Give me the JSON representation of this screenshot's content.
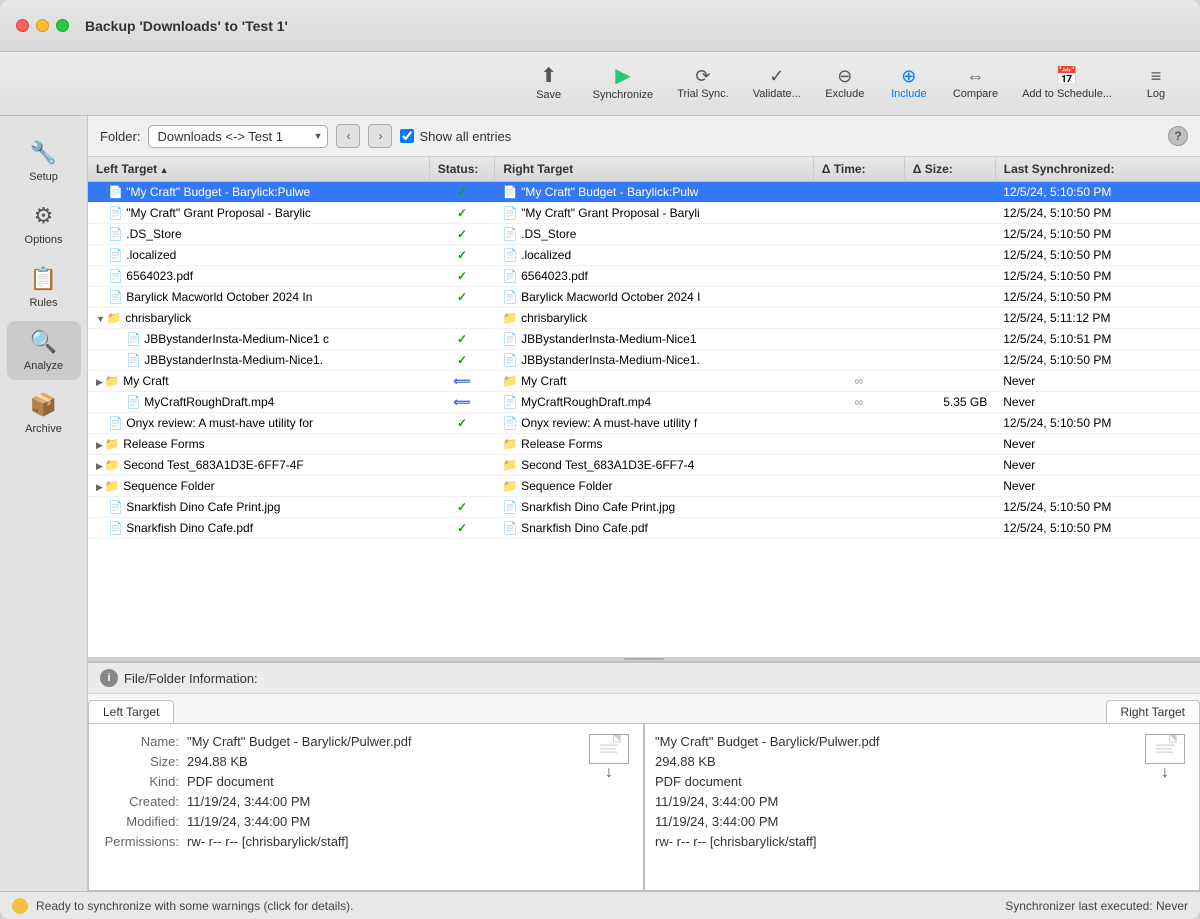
{
  "window": {
    "title": "Backup 'Downloads' to 'Test 1'"
  },
  "toolbar": {
    "items": [
      {
        "id": "save",
        "label": "Save",
        "icon": "⬆"
      },
      {
        "id": "synchronize",
        "label": "Synchronize",
        "icon": "▶"
      },
      {
        "id": "trial-sync",
        "label": "Trial Sync.",
        "icon": "⟳"
      },
      {
        "id": "validate",
        "label": "Validate...",
        "icon": "✓"
      },
      {
        "id": "exclude",
        "label": "Exclude",
        "icon": "⊖"
      },
      {
        "id": "include",
        "label": "Include",
        "icon": "⊕"
      },
      {
        "id": "compare",
        "label": "Compare",
        "icon": "⇔"
      },
      {
        "id": "add-schedule",
        "label": "Add to Schedule...",
        "icon": "📅"
      },
      {
        "id": "log",
        "label": "Log",
        "icon": "≡"
      }
    ]
  },
  "sidebar": {
    "items": [
      {
        "id": "setup",
        "label": "Setup",
        "icon": "🔧"
      },
      {
        "id": "options",
        "label": "Options",
        "icon": "⚙"
      },
      {
        "id": "rules",
        "label": "Rules",
        "icon": "📋"
      },
      {
        "id": "analyze",
        "label": "Analyze",
        "icon": "🔍"
      },
      {
        "id": "archive",
        "label": "Archive",
        "icon": "📦"
      }
    ]
  },
  "folder_bar": {
    "label": "Folder:",
    "folder_value": "Downloads <-> Test 1",
    "show_all_label": "Show all entries",
    "show_all_checked": true
  },
  "table": {
    "headers": {
      "left_target": "Left Target",
      "status": "Status:",
      "right_target": "Right Target",
      "delta_time": "Δ Time:",
      "delta_size": "Δ Size:",
      "last_sync": "Last Synchronized:"
    },
    "rows": [
      {
        "id": "row-1",
        "selected": true,
        "indent": 0,
        "expand": false,
        "left_icon": "📄",
        "left_name": "\"My Craft\" Budget - Barylick:Pulwe",
        "status": "✓",
        "right_icon": "📄",
        "right_name": "\"My Craft\" Budget - Barylick:Pulw",
        "delta_time": "",
        "delta_size": "",
        "last_sync": "12/5/24, 5:10:50 PM"
      },
      {
        "id": "row-2",
        "selected": false,
        "indent": 0,
        "expand": false,
        "left_icon": "📄",
        "left_name": "\"My Craft\" Grant Proposal - Barylic",
        "status": "✓",
        "right_icon": "📄",
        "right_name": "\"My Craft\" Grant Proposal - Baryli",
        "delta_time": "",
        "delta_size": "",
        "last_sync": "12/5/24, 5:10:50 PM"
      },
      {
        "id": "row-3",
        "selected": false,
        "indent": 0,
        "expand": false,
        "left_icon": "📄",
        "left_name": ".DS_Store",
        "status": "✓",
        "right_icon": "📄",
        "right_name": ".DS_Store",
        "delta_time": "",
        "delta_size": "",
        "last_sync": "12/5/24, 5:10:50 PM"
      },
      {
        "id": "row-4",
        "selected": false,
        "indent": 0,
        "expand": false,
        "left_icon": "📄",
        "left_name": ".localized",
        "status": "✓",
        "right_icon": "📄",
        "right_name": ".localized",
        "delta_time": "",
        "delta_size": "",
        "last_sync": "12/5/24, 5:10:50 PM"
      },
      {
        "id": "row-5",
        "selected": false,
        "indent": 0,
        "expand": false,
        "left_icon": "📄",
        "left_name": "6564023.pdf",
        "status": "✓",
        "right_icon": "📄",
        "right_name": "6564023.pdf",
        "delta_time": "",
        "delta_size": "",
        "last_sync": "12/5/24, 5:10:50 PM"
      },
      {
        "id": "row-6",
        "selected": false,
        "indent": 0,
        "expand": false,
        "left_icon": "📄",
        "left_name": "Barylick Macworld October 2024 In",
        "status": "✓",
        "right_icon": "📄",
        "right_name": "Barylick Macworld October 2024 I",
        "delta_time": "",
        "delta_size": "",
        "last_sync": "12/5/24, 5:10:50 PM"
      },
      {
        "id": "row-7",
        "selected": false,
        "indent": 0,
        "expand": true,
        "folder": true,
        "left_icon": "📁",
        "left_name": "chrisbarylick",
        "status": "",
        "right_icon": "📁",
        "right_name": "chrisbarylick",
        "delta_time": "",
        "delta_size": "",
        "last_sync": "12/5/24, 5:11:12 PM"
      },
      {
        "id": "row-8",
        "selected": false,
        "indent": 1,
        "expand": false,
        "left_icon": "📄",
        "left_name": "JBBystanderInsta-Medium-Nice1 c",
        "status": "✓",
        "right_icon": "📄",
        "right_name": "JBBystanderInsta-Medium-Nice1",
        "delta_time": "",
        "delta_size": "",
        "last_sync": "12/5/24, 5:10:51 PM"
      },
      {
        "id": "row-9",
        "selected": false,
        "indent": 1,
        "expand": false,
        "left_icon": "📄",
        "left_name": "JBBystanderInsta-Medium-Nice1.",
        "status": "✓",
        "right_icon": "📄",
        "right_name": "JBBystanderInsta-Medium-Nice1.",
        "delta_time": "",
        "delta_size": "",
        "last_sync": "12/5/24, 5:10:50 PM"
      },
      {
        "id": "row-10",
        "selected": false,
        "indent": 0,
        "expand": false,
        "folder": true,
        "left_icon": "📁",
        "left_name": "My Craft",
        "status": "←",
        "right_icon": "📁",
        "right_name": "My Craft",
        "delta_time": "∞",
        "delta_size": "",
        "last_sync": "Never"
      },
      {
        "id": "row-11",
        "selected": false,
        "indent": 1,
        "expand": false,
        "left_icon": "📄",
        "left_name": "MyCraftRoughDraft.mp4",
        "status": "←",
        "right_icon": "📄",
        "right_name": "MyCraftRoughDraft.mp4",
        "delta_time": "∞",
        "delta_size": "5.35 GB",
        "last_sync": "Never"
      },
      {
        "id": "row-12",
        "selected": false,
        "indent": 0,
        "expand": false,
        "left_icon": "📄",
        "left_name": "Onyx review: A must-have utility for",
        "status": "✓",
        "right_icon": "📄",
        "right_name": "Onyx review: A must-have utility f",
        "delta_time": "",
        "delta_size": "",
        "last_sync": "12/5/24, 5:10:50 PM"
      },
      {
        "id": "row-13",
        "selected": false,
        "indent": 0,
        "expand": false,
        "folder": true,
        "expandable": true,
        "left_icon": "📁",
        "left_name": "Release Forms",
        "status": "",
        "right_icon": "📁",
        "right_name": "Release Forms",
        "delta_time": "",
        "delta_size": "",
        "last_sync": "Never"
      },
      {
        "id": "row-14",
        "selected": false,
        "indent": 0,
        "expand": false,
        "folder": true,
        "expandable": true,
        "left_icon": "📁",
        "left_name": "Second Test_683A1D3E-6FF7-4F",
        "status": "",
        "right_icon": "📁",
        "right_name": "Second Test_683A1D3E-6FF7-4",
        "delta_time": "",
        "delta_size": "",
        "last_sync": "Never"
      },
      {
        "id": "row-15",
        "selected": false,
        "indent": 0,
        "expand": false,
        "folder": true,
        "expandable": true,
        "left_icon": "📁",
        "left_name": "Sequence Folder",
        "status": "",
        "right_icon": "📁",
        "right_name": "Sequence Folder",
        "delta_time": "",
        "delta_size": "",
        "last_sync": "Never"
      },
      {
        "id": "row-16",
        "selected": false,
        "indent": 0,
        "expand": false,
        "left_icon": "📄",
        "left_name": "Snarkfish Dino Cafe Print.jpg",
        "status": "✓",
        "right_icon": "📄",
        "right_name": "Snarkfish Dino Cafe Print.jpg",
        "delta_time": "",
        "delta_size": "",
        "last_sync": "12/5/24, 5:10:50 PM"
      },
      {
        "id": "row-17",
        "selected": false,
        "indent": 0,
        "expand": false,
        "left_icon": "📄",
        "left_name": "Snarkfish Dino Cafe.pdf",
        "status": "✓",
        "right_icon": "📄",
        "right_name": "Snarkfish Dino Cafe.pdf",
        "delta_time": "",
        "delta_size": "",
        "last_sync": "12/5/24, 5:10:50 PM"
      }
    ]
  },
  "bottom_panel": {
    "title": "File/Folder Information:",
    "left_tab": "Left Target",
    "right_tab": "Right Target",
    "left_info": {
      "name_label": "Name:",
      "name_value": "\"My Craft\" Budget - Barylick/Pulwer.pdf",
      "size_label": "Size:",
      "size_value": "294.88 KB",
      "kind_label": "Kind:",
      "kind_value": "PDF document",
      "created_label": "Created:",
      "created_value": "11/19/24, 3:44:00 PM",
      "modified_label": "Modified:",
      "modified_value": "11/19/24, 3:44:00 PM",
      "permissions_label": "Permissions:",
      "permissions_value": "rw- r-- r--  [chrisbarylick/staff]"
    },
    "right_info": {
      "name_value": "\"My Craft\" Budget - Barylick/Pulwer.pdf",
      "size_value": "294.88 KB",
      "kind_value": "PDF document",
      "created_value": "11/19/24, 3:44:00 PM",
      "modified_value": "11/19/24, 3:44:00 PM",
      "permissions_value": "rw- r-- r--  [chrisbarylick/staff]"
    }
  },
  "status_bar": {
    "left_text": "Ready to synchronize with some warnings (click for details).",
    "right_text": "Synchronizer last executed:  Never"
  }
}
